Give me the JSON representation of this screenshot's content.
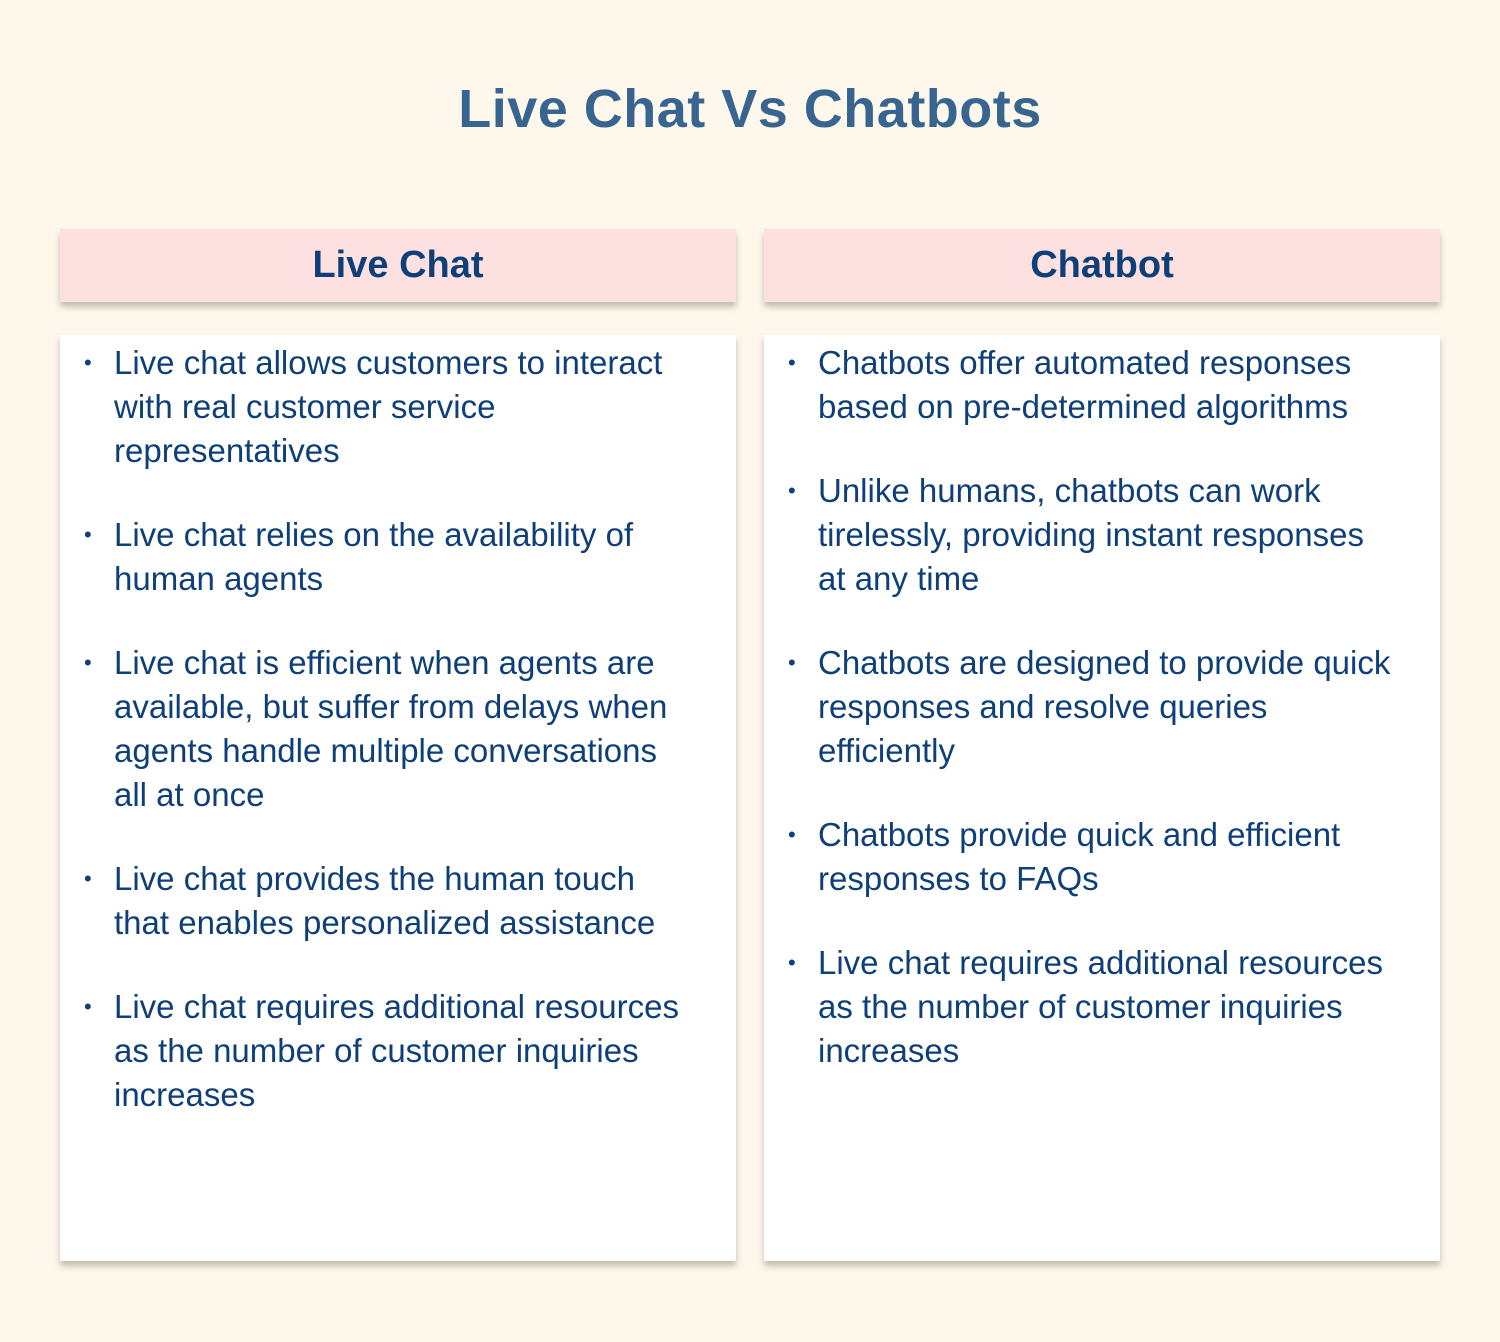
{
  "title": "Live Chat Vs Chatbots",
  "columns": [
    {
      "header": "Live Chat",
      "items": [
        "Live chat allows customers to interact with real customer service representatives",
        "Live chat relies on the availability of human agents",
        "Live chat is efficient when agents are available, but suffer from delays when agents handle multiple conversations all at once",
        "Live chat provides the human touch that enables personalized assistance",
        "Live chat  requires additional resources as the number of customer inquiries increases"
      ]
    },
    {
      "header": "Chatbot",
      "items": [
        "Chatbots offer automated responses based on pre-determined algorithms",
        "Unlike humans, chatbots can work tirelessly, providing instant responses at any time",
        "Chatbots are designed to provide quick responses and resolve queries efficiently",
        "Chatbots provide quick and efficient responses to FAQs",
        "Live chat  requires additional resources as the number of customer inquiries increases"
      ]
    }
  ],
  "bullet_glyph": "•",
  "colors": {
    "background": "#fef8ec",
    "title": "#37658f",
    "header_bg": "#fde1e1",
    "text": "#0e3f78",
    "card_bg": "#ffffff"
  }
}
